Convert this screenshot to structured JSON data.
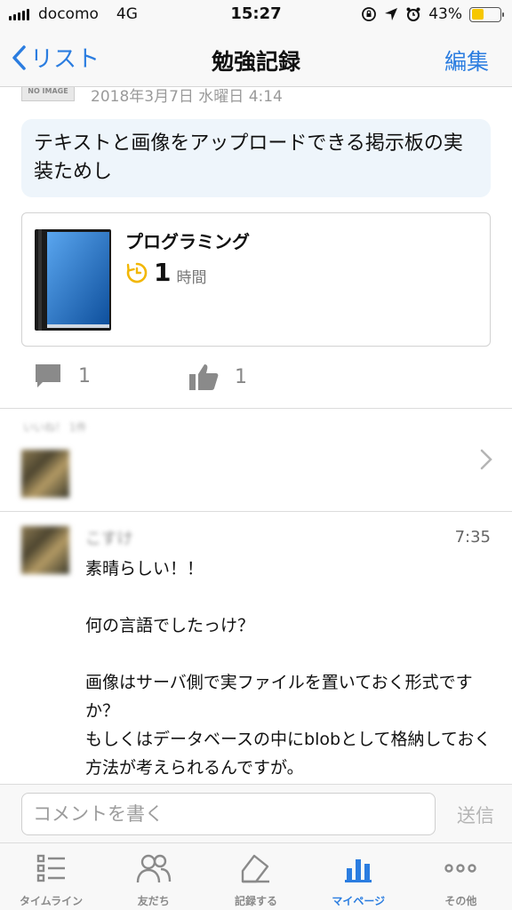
{
  "status": {
    "carrier": "docomo",
    "network": "4G",
    "time": "15:27",
    "battery": "43%",
    "battery_level": 0.43
  },
  "nav": {
    "back_label": "リスト",
    "title": "勉強記録",
    "edit_label": "編集"
  },
  "post": {
    "thumb_label": "NO IMAGE",
    "date": "2018年3月7日 水曜日 4:14",
    "text": "テキストと画像をアップロードできる掲示板の実装ためし"
  },
  "book": {
    "title": "プログラミング",
    "hours": "1",
    "unit": "時間",
    "cover_color": "#1d72c9"
  },
  "actions": {
    "comments": "1",
    "likes": "1"
  },
  "likes": {
    "label": "いいね！ 1件"
  },
  "comment": {
    "name": "こすけ",
    "time": "7:35",
    "body": "素晴らしい！！\n\n何の言語でしたっけ？\n\n画像はサーバ側で実ファイルを置いておく形式ですか？\nもしくはデータベースの中にblobとして格納しておく方法が考えられるんですが。"
  },
  "input": {
    "placeholder": "コメントを書く",
    "send_label": "送信"
  },
  "tabs": [
    {
      "label": "タイムライン",
      "icon": "list-icon"
    },
    {
      "label": "友だち",
      "icon": "friends-icon"
    },
    {
      "label": "記録する",
      "icon": "record-icon"
    },
    {
      "label": "マイページ",
      "icon": "chart-icon",
      "active": true
    },
    {
      "label": "その他",
      "icon": "more-icon"
    }
  ],
  "colors": {
    "accent": "#2b7de0",
    "timer": "#f2b705",
    "bubble": "#eef5fb"
  }
}
